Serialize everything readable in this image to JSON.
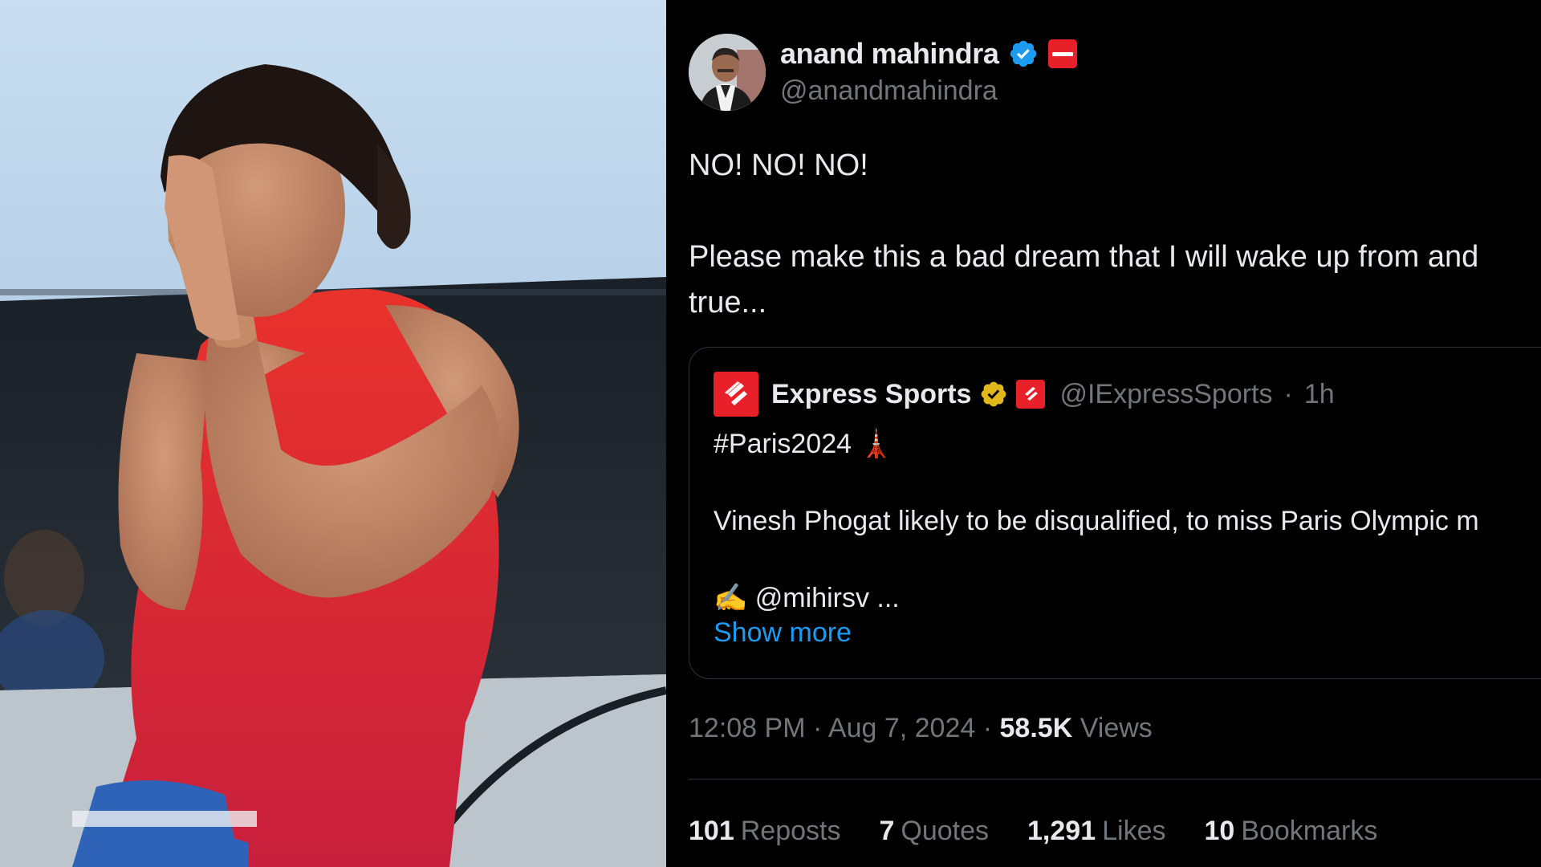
{
  "photo": {
    "description_icon": "athlete-photo"
  },
  "tweet": {
    "author": {
      "name": "anand mahindra",
      "handle": "@anandmahindra",
      "verified_color": "#1d9bf0",
      "affiliation_color": "#e8202a"
    },
    "body": {
      "line1": "NO! NO! NO!",
      "line2": "Please make this a bad dream that I will wake up from and",
      "line3": "true..."
    },
    "quote": {
      "name": "Express Sports",
      "handle": "@IExpressSports",
      "separator": "·",
      "time": "1h",
      "hashtag": "#Paris2024",
      "hashtag_emoji": "🗼",
      "text": "Vinesh Phogat likely to be disqualified, to miss Paris Olympic m",
      "author_emoji": "✍️",
      "author_mention": "@mihirsv ...",
      "show_more": "Show more",
      "brand_color": "#e8202a",
      "gold_badge_color": "#e2b719"
    },
    "meta": {
      "time": "12:08 PM",
      "sep1": "·",
      "date": "Aug 7, 2024",
      "sep2": "·",
      "views_count": "58.5K",
      "views_label": "Views"
    },
    "stats": {
      "reposts_count": "101",
      "reposts_label": "Reposts",
      "quotes_count": "7",
      "quotes_label": "Quotes",
      "likes_count": "1,291",
      "likes_label": "Likes",
      "bookmarks_count": "10",
      "bookmarks_label": "Bookmarks"
    },
    "link_color": "#1d9bf0"
  }
}
